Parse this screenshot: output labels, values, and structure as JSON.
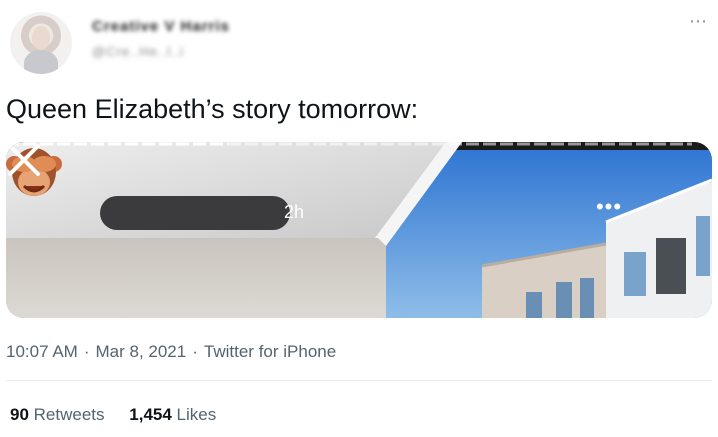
{
  "header": {
    "display_name": "Creative V Harris",
    "handle": "@Cre..He..l..i",
    "more_icon": "more-horizontal-icon"
  },
  "tweet": {
    "text": "Queen Elizabeth’s story tomorrow:"
  },
  "story": {
    "avatar_emoji": "🙈",
    "time": "2h",
    "more_label": "•••",
    "close_icon": "close-icon"
  },
  "meta": {
    "time": "10:07 AM",
    "date": "Mar 8, 2021",
    "source": "Twitter for iPhone",
    "sep": "·"
  },
  "stats": {
    "retweets_count": "90",
    "retweets_label": "Retweets",
    "likes_count": "1,454",
    "likes_label": "Likes"
  },
  "colors": {
    "accent_text": "#536471",
    "name_bar": "#3b3b3d",
    "sky": "#2f7fd8"
  }
}
